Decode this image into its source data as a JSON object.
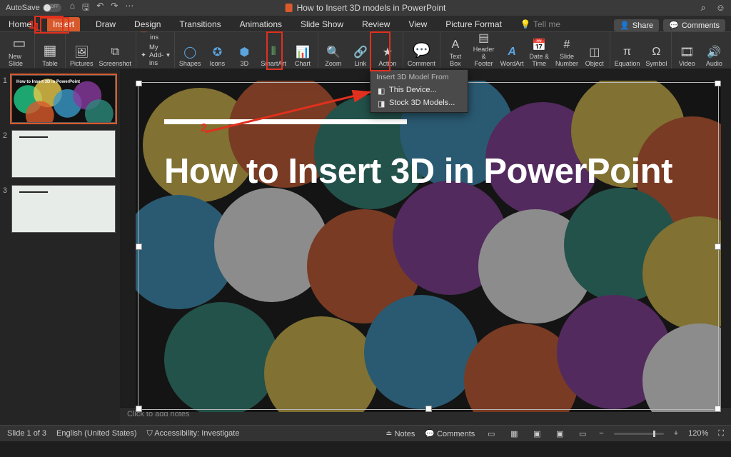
{
  "titlebar": {
    "autosave": "AutoSave",
    "document_title": "How to Insert 3D models in PowerPoint"
  },
  "qat": {
    "home": "⌂",
    "save": "🖫",
    "undo": "↶",
    "redo": "↷",
    "more": "⋯"
  },
  "tabs": {
    "home": "Home",
    "insert": "Insert",
    "draw": "Draw",
    "design": "Design",
    "transitions": "Transitions",
    "animations": "Animations",
    "slideshow": "Slide Show",
    "review": "Review",
    "view": "View",
    "pictureformat": "Picture Format",
    "tellme": "Tell me"
  },
  "tabs_right": {
    "share": "Share",
    "comments": "Comments"
  },
  "ribbon": {
    "new_slide": "New Slide",
    "table": "Table",
    "pictures": "Pictures",
    "screenshot": "Screenshot",
    "get_addins": "Get Add-ins",
    "my_addins": "My Add-ins",
    "shapes": "Shapes",
    "icons": "Icons",
    "models3d": "3D",
    "smartart": "SmartArt",
    "chart": "Chart",
    "zoom": "Zoom",
    "link": "Link",
    "action": "Action",
    "comment": "Comment",
    "textbox": "Text Box",
    "headerfooter": "Header & Footer",
    "wordart": "WordArt",
    "datetime": "Date & Time",
    "slidenumber": "Slide Number",
    "object": "Object",
    "equation": "Equation",
    "symbol": "Symbol",
    "video": "Video",
    "audio": "Audio"
  },
  "dropdown": {
    "header": "Insert 3D Model From",
    "this_device": "This Device...",
    "stock": "Stock 3D Models..."
  },
  "slide": {
    "title": "How to Insert 3D in PowerPoint",
    "thumb1_title": "How to Insert 3D in PowerPoint"
  },
  "notes": {
    "placeholder": "Click to add notes"
  },
  "status": {
    "slide_of": "Slide 1 of 3",
    "lang": "English (United States)",
    "access": "Accessibility: Investigate",
    "notes": "Notes",
    "comments": "Comments",
    "zoom": "120%"
  },
  "anno": {
    "one": "1",
    "two": "2"
  }
}
